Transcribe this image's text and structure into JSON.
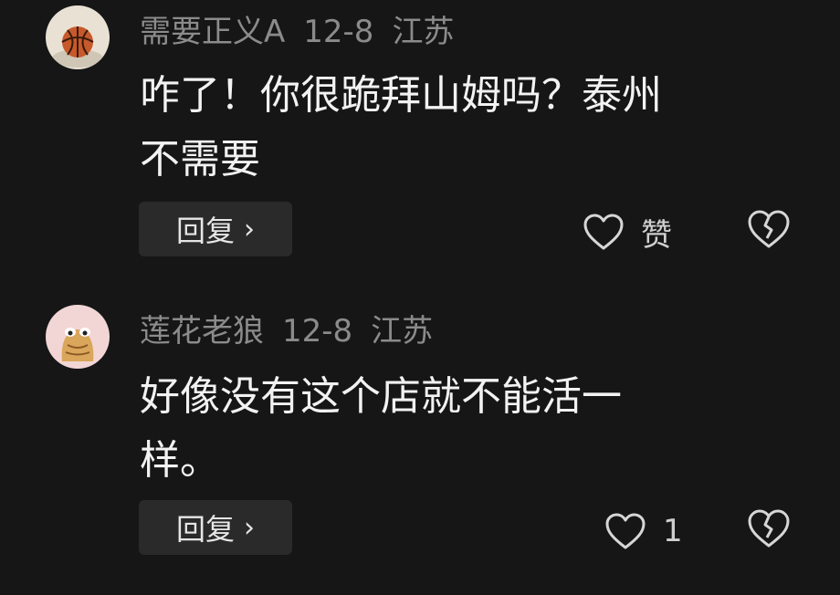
{
  "comments": [
    {
      "username": "需要正义A",
      "date": "12-8",
      "location": "江苏",
      "text_lines": [
        "咋了！你很跪拜山姆吗？泰州",
        "不需要"
      ],
      "reply_label": "回复",
      "like_label": "赞",
      "avatar": "basketball"
    },
    {
      "username": "莲花老狼",
      "date": "12-8",
      "location": "江苏",
      "text_lines": [
        "好像没有这个店就不能活一",
        "样。"
      ],
      "reply_label": "回复",
      "like_label": "1",
      "avatar": "cartoon-creature"
    }
  ],
  "icons": {
    "reply_chevron": "chevron-right-icon",
    "like": "heart-outline-icon",
    "dislike": "broken-heart-icon"
  }
}
